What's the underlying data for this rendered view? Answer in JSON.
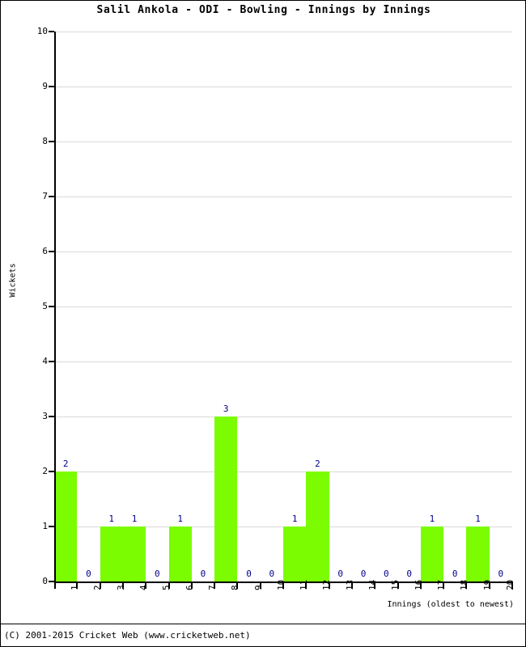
{
  "chart_data": {
    "type": "bar",
    "title": "Salil Ankola - ODI - Bowling - Innings by Innings",
    "xlabel": "Innings (oldest to newest)",
    "ylabel": "Wickets",
    "categories": [
      "1",
      "2",
      "3",
      "4",
      "5",
      "6",
      "7",
      "8",
      "9",
      "10",
      "11",
      "12",
      "13",
      "14",
      "15",
      "16",
      "17",
      "18",
      "19",
      "20"
    ],
    "values": [
      2,
      0,
      1,
      1,
      0,
      1,
      0,
      3,
      0,
      0,
      1,
      2,
      0,
      0,
      0,
      0,
      1,
      0,
      1,
      0
    ],
    "value_labels": [
      "2",
      "0",
      "1",
      "1",
      "0",
      "1",
      "0",
      "3",
      "0",
      "0",
      "1",
      "2",
      "0",
      "0",
      "0",
      "0",
      "1",
      "0",
      "1",
      "0"
    ],
    "ylim": [
      0,
      10
    ],
    "ytick_labels": [
      "0",
      "1",
      "2",
      "3",
      "4",
      "5",
      "6",
      "7",
      "8",
      "9",
      "10"
    ],
    "ytick_values": [
      0,
      1,
      2,
      3,
      4,
      5,
      6,
      7,
      8,
      9,
      10
    ],
    "grid": true,
    "grid_axis": "y",
    "legend": null,
    "bar_color": "#7cfc00",
    "value_label_color": "#00008b",
    "grid_color": "#d9d9d9",
    "axis_color": "#000000",
    "background_color": "#ffffff"
  },
  "footer": {
    "copyright": "(C) 2001-2015 Cricket Web (www.cricketweb.net)"
  }
}
